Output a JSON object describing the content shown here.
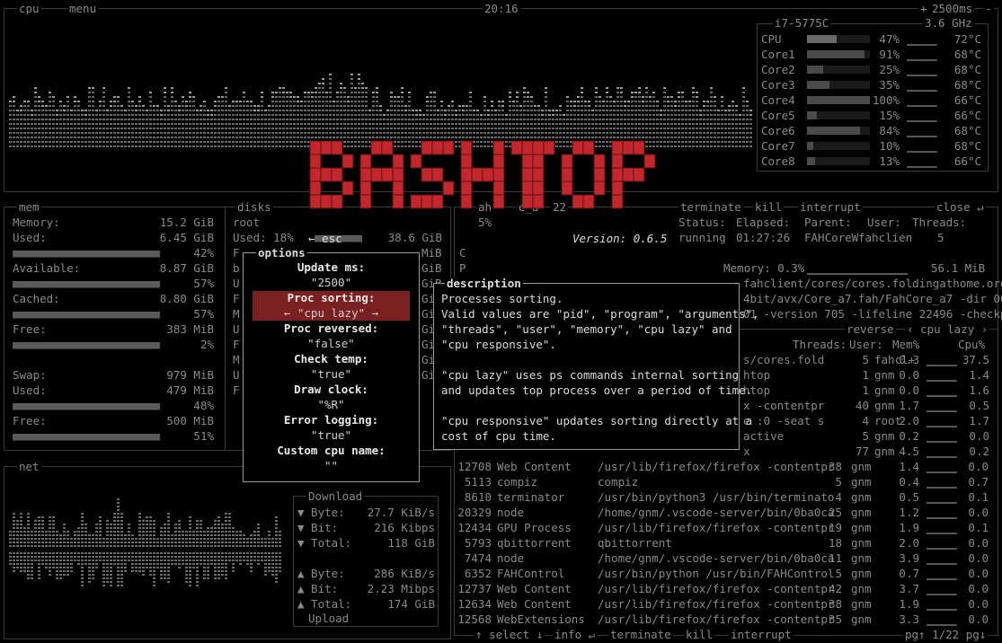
{
  "top": {
    "cpu_label": "cpu",
    "menu_label": "menu",
    "clock": "20:16",
    "interval": "2500ms",
    "interval_minus": "-",
    "interval_plus": "+"
  },
  "cpu_panel": {
    "model": "i7-5775C",
    "freq": "3.6 GHz",
    "rows": [
      {
        "name": "CPU",
        "pct": "47%",
        "temp": "72°C",
        "fill": 0.47
      },
      {
        "name": "Core1",
        "pct": "91%",
        "temp": "68°C",
        "fill": 0.91
      },
      {
        "name": "Core2",
        "pct": "25%",
        "temp": "68°C",
        "fill": 0.25
      },
      {
        "name": "Core3",
        "pct": "35%",
        "temp": "68°C",
        "fill": 0.35
      },
      {
        "name": "Core4",
        "pct": "100%",
        "temp": "66°C",
        "fill": 1.0
      },
      {
        "name": "Core5",
        "pct": "15%",
        "temp": "66°C",
        "fill": 0.15
      },
      {
        "name": "Core6",
        "pct": "84%",
        "temp": "68°C",
        "fill": 0.84
      },
      {
        "name": "Core7",
        "pct": "10%",
        "temp": "68°C",
        "fill": 0.1
      },
      {
        "name": "Core8",
        "pct": "13%",
        "temp": "66°C",
        "fill": 0.13
      }
    ]
  },
  "mem": {
    "label": "mem",
    "rows": [
      {
        "name": "Memory:",
        "value": "15.2 GiB",
        "pct": ""
      },
      {
        "name": "Used:",
        "value": "6.45 GiB",
        "pct": "42%"
      },
      {
        "name": "Available:",
        "value": "8.87 GiB",
        "pct": "57%"
      },
      {
        "name": "Cached:",
        "value": "8.80 GiB",
        "pct": "57%"
      },
      {
        "name": "Free:",
        "value": "383 MiB",
        "pct": "2%"
      },
      {
        "name": "Swap:",
        "value": "979 MiB",
        "pct": ""
      },
      {
        "name": "Used:",
        "value": "479 MiB",
        "pct": "48%"
      },
      {
        "name": "Free:",
        "value": "500 MiB",
        "pct": "51%"
      }
    ]
  },
  "disks": {
    "label": "disks",
    "root": "root",
    "used": "Used: 18%",
    "used_val": "38.6 GiB",
    "partial_left": [
      "F",
      "b",
      "U",
      "F",
      "M",
      "U",
      "F",
      "M",
      "U",
      "F"
    ],
    "partial_right": [
      "MiB",
      "GiB",
      "GiB",
      "GiB",
      "GiB",
      "GiB",
      "GiB",
      "GiB",
      "GiB"
    ]
  },
  "logo": {
    "text": "BASHTOP",
    "version": "Version: 0.6.5",
    "esc": "← esc"
  },
  "options": {
    "title": "options",
    "items": [
      {
        "label": "Update ms:",
        "value": "\"2500\""
      },
      {
        "label": "Proc sorting:",
        "value": "← \"cpu lazy\" →"
      },
      {
        "label": "Proc reversed:",
        "value": "\"false\""
      },
      {
        "label": "Check temp:",
        "value": "\"true\""
      },
      {
        "label": "Draw clock:",
        "value": "\"%R\""
      },
      {
        "label": "Error logging:",
        "value": "\"true\""
      },
      {
        "label": "Custom cpu name:",
        "value": "\"\""
      }
    ]
  },
  "description": {
    "title": "description",
    "lines": [
      "Processes sorting.",
      "Valid values are \"pid\", \"program\", \"arguments\",",
      "\"threads\", \"user\", \"memory\", \"cpu lazy\" and",
      "\"cpu responsive\".",
      "",
      "\"cpu lazy\" uses ps commands internal sorting",
      "and updates top process over a period of time.",
      "",
      "\"cpu responsive\" updates sorting directly at a",
      "cost of cpu time."
    ]
  },
  "detail": {
    "terminate": "terminate",
    "kill": "kill",
    "interrupt": "interrupt",
    "close": "close ↵",
    "proc_name_partial": "ah",
    "proc_partial": "e_a",
    "pid_partial": "22",
    "pct_partial": "5%",
    "headers": [
      "Status:",
      "Elapsed:",
      "Parent:",
      "User:",
      "Threads:"
    ],
    "values": [
      "running",
      "01:27:26",
      "FAHCoreW",
      "fahclien",
      "5"
    ],
    "memory": "Memory: 0.3%",
    "memory_val": "56.1 MiB",
    "cmd_lines": [
      "fahclient/cores/cores.foldingathome.org",
      "4bit/avx/Core_a7.fah/FahCore_a7 -dir 00",
      "01 -version 705 -lifeline 22496 -checkp"
    ],
    "c_letter": "C",
    "p_letter": "P"
  },
  "proc": {
    "reverse": "reverse",
    "sort": "‹ cpu lazy ›",
    "threads_hdr": "Threads:",
    "user_hdr": "User:",
    "mem_hdr": "Mem%",
    "cpu_hdr": "Cpu%",
    "top_rows": [
      {
        "args": "s/cores.fold",
        "threads": "5",
        "user": "fahcl+",
        "mem": "0.3",
        "cpu": "37.5"
      },
      {
        "args": "htop",
        "threads": "1",
        "user": "gnm",
        "mem": "0.0",
        "cpu": "1.4"
      },
      {
        "args": "htop",
        "threads": "1",
        "user": "gnm",
        "mem": "0.0",
        "cpu": "1.6"
      },
      {
        "args": "x -contentpr",
        "threads": "40",
        "user": "gnm",
        "mem": "1.7",
        "cpu": "0.5"
      },
      {
        "args": "e :0 -seat s",
        "threads": "4",
        "user": "root",
        "mem": "2.0",
        "cpu": "1.7"
      },
      {
        "args": "active",
        "threads": "5",
        "user": "gnm",
        "mem": "0.2",
        "cpu": "0.0"
      },
      {
        "args": "x",
        "threads": "77",
        "user": "gnm",
        "mem": "4.5",
        "cpu": "0.2"
      }
    ],
    "rows": [
      {
        "pid": "12708",
        "prog": "Web Content",
        "args": "/usr/lib/firefox/firefox -contentpr",
        "threads": "38",
        "user": "gnm",
        "mem": "1.4",
        "cpu": "0.0"
      },
      {
        "pid": "5113",
        "prog": "compiz",
        "args": "compiz",
        "threads": "5",
        "user": "gnm",
        "mem": "0.4",
        "cpu": "0.7"
      },
      {
        "pid": "8610",
        "prog": "terminator",
        "args": "/usr/bin/python3 /usr/bin/terminato",
        "threads": "4",
        "user": "gnm",
        "mem": "0.5",
        "cpu": "0.1"
      },
      {
        "pid": "20329",
        "prog": "node",
        "args": "/home/gnm/.vscode-server/bin/0ba0ca",
        "threads": "25",
        "user": "gnm",
        "mem": "1.2",
        "cpu": "0.0"
      },
      {
        "pid": "12434",
        "prog": "GPU Process",
        "args": "/usr/lib/firefox/firefox -contentpr",
        "threads": "19",
        "user": "gnm",
        "mem": "1.9",
        "cpu": "0.1"
      },
      {
        "pid": "5793",
        "prog": "qbittorrent",
        "args": "qbittorrent",
        "threads": "18",
        "user": "gnm",
        "mem": "2.0",
        "cpu": "0.0"
      },
      {
        "pid": "7474",
        "prog": "node",
        "args": "/home/gnm/.vscode-server/bin/0ba0ca",
        "threads": "11",
        "user": "gnm",
        "mem": "3.9",
        "cpu": "0.0"
      },
      {
        "pid": "6352",
        "prog": "FAHControl",
        "args": "/usr/bin/python /usr/bin/FAHControl",
        "threads": "5",
        "user": "gnm",
        "mem": "0.7",
        "cpu": "0.0"
      },
      {
        "pid": "12737",
        "prog": "Web Content",
        "args": "/usr/lib/firefox/firefox -contentpr",
        "threads": "42",
        "user": "gnm",
        "mem": "3.7",
        "cpu": "0.0"
      },
      {
        "pid": "12634",
        "prog": "Web Content",
        "args": "/usr/lib/firefox/firefox -contentpr",
        "threads": "38",
        "user": "gnm",
        "mem": "1.9",
        "cpu": "0.0"
      },
      {
        "pid": "12568",
        "prog": "WebExtensions",
        "args": "/usr/lib/firefox/firefox -contentpr",
        "threads": "35",
        "user": "gnm",
        "mem": "3.3",
        "cpu": "0.0"
      }
    ],
    "footer": {
      "select": "↑ select ↓",
      "info": "info ↵",
      "terminate": "terminate",
      "kill": "kill",
      "interrupt": "interrupt",
      "page": "pg↑ 1/22 pg↓"
    }
  },
  "net": {
    "label": "net",
    "download": "Download",
    "upload": "Upload",
    "dl": [
      {
        "name": "▼ Byte:",
        "value": "27.7 KiB/s"
      },
      {
        "name": "▼ Bit:",
        "value": "216 Kibps"
      },
      {
        "name": "▼ Total:",
        "value": "118 GiB"
      }
    ],
    "ul": [
      {
        "name": "▲ Byte:",
        "value": "286 KiB/s"
      },
      {
        "name": "▲ Bit:",
        "value": "2.23 Mibps"
      },
      {
        "name": "▲ Total:",
        "value": "174 GiB"
      }
    ]
  },
  "colors": {
    "accent_red": "#c1272d",
    "highlight": "#7a2020"
  }
}
